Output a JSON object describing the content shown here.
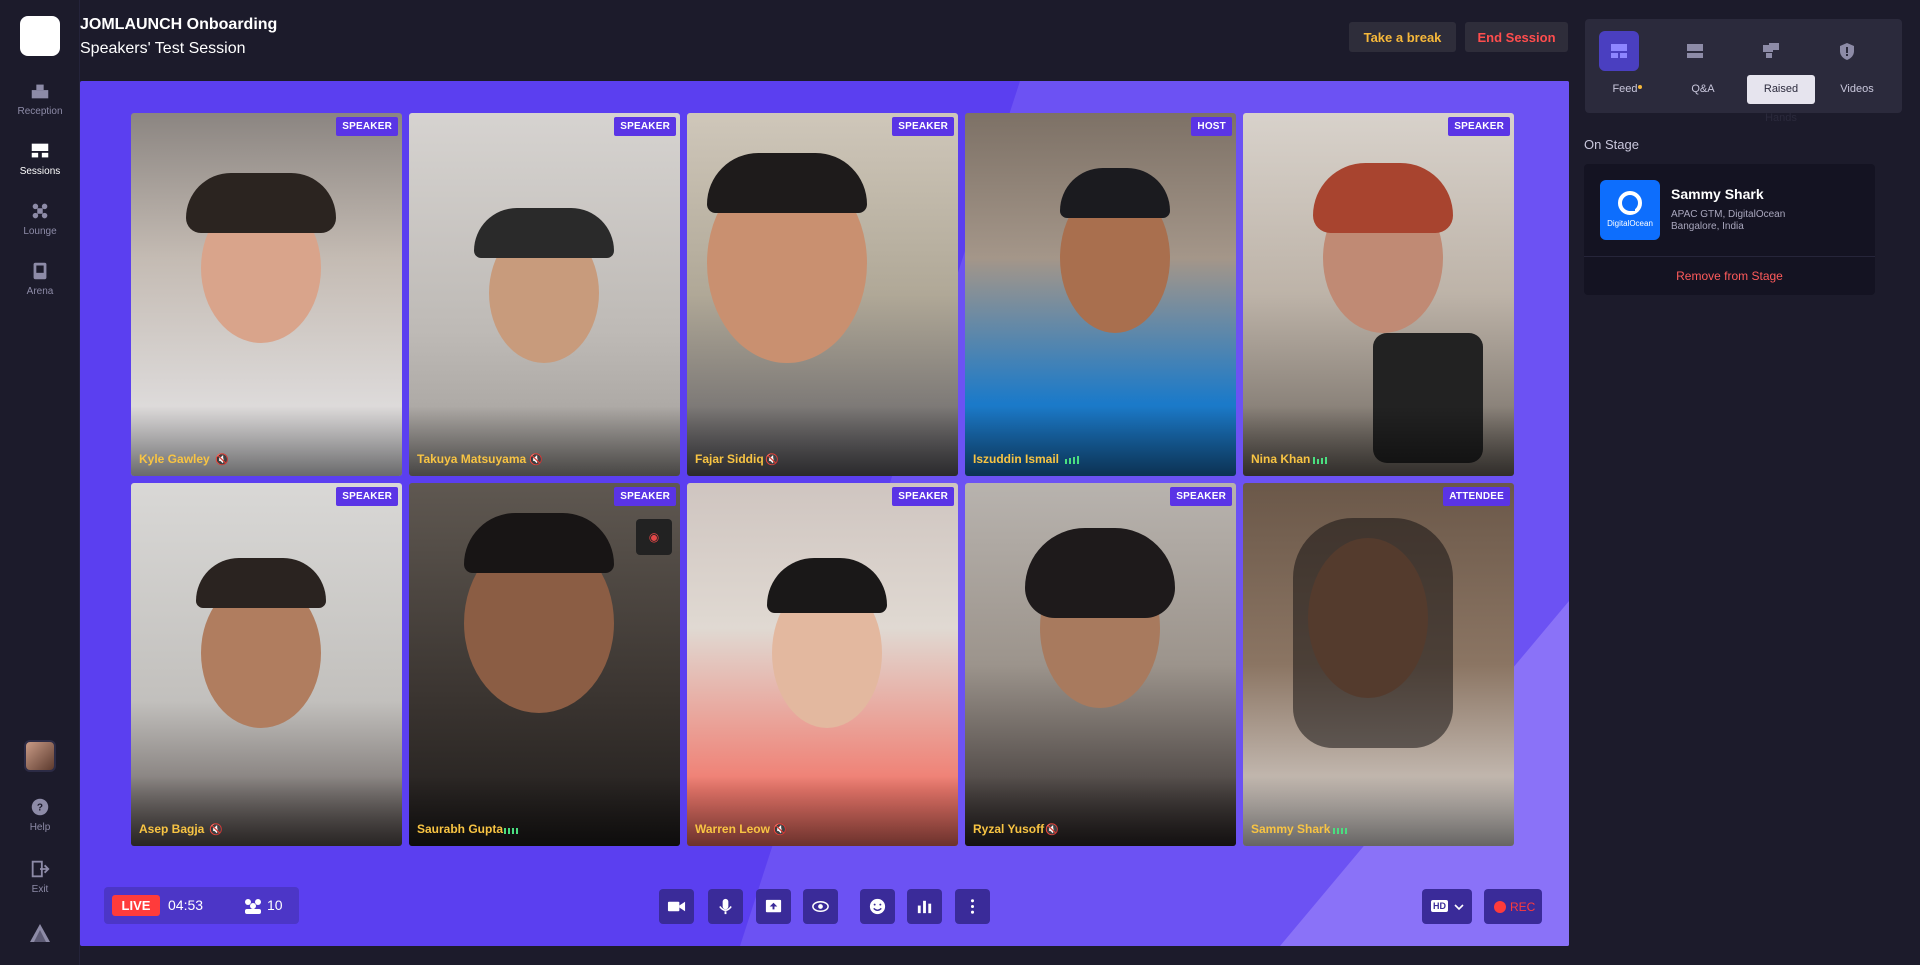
{
  "app": {
    "title": "JOMLAUNCH Onboarding",
    "subtitle": "Speakers' Test Session"
  },
  "nav": {
    "items": [
      {
        "label": "Reception",
        "icon": "reception-icon",
        "active": false
      },
      {
        "label": "Sessions",
        "icon": "sessions-icon",
        "active": true
      },
      {
        "label": "Lounge",
        "icon": "lounge-icon",
        "active": false
      },
      {
        "label": "Arena",
        "icon": "arena-icon",
        "active": false
      }
    ],
    "help": "Help",
    "exit": "Exit"
  },
  "header": {
    "break_label": "Take a break",
    "end_label": "End Session"
  },
  "participants": [
    {
      "name": "Kyle Gawley",
      "role": "SPEAKER",
      "audio": "muted"
    },
    {
      "name": "Takuya Matsuyama",
      "role": "SPEAKER",
      "audio": "muted"
    },
    {
      "name": "Fajar Siddiq",
      "role": "SPEAKER",
      "audio": "muted"
    },
    {
      "name": "Iszuddin Ismail",
      "role": "HOST",
      "audio": "speaking"
    },
    {
      "name": "Nina Khan",
      "role": "SPEAKER",
      "audio": "speaking"
    },
    {
      "name": "Asep Bagja",
      "role": "SPEAKER",
      "audio": "muted"
    },
    {
      "name": "Saurabh Gupta",
      "role": "SPEAKER",
      "audio": "speaking"
    },
    {
      "name": "Warren Leow",
      "role": "SPEAKER",
      "audio": "muted"
    },
    {
      "name": "Ryzal Yusoff",
      "role": "SPEAKER",
      "audio": "muted"
    },
    {
      "name": "Sammy Shark",
      "role": "ATTENDEE",
      "audio": "speaking"
    }
  ],
  "bottom_bar": {
    "live_label": "LIVE",
    "timer": "04:53",
    "attendee_count": "10",
    "quality_label": "HD",
    "rec_label": "REC"
  },
  "panel": {
    "tabs": [
      {
        "label": "Feed",
        "icon": "feed-icon",
        "active": false,
        "dot": true
      },
      {
        "label": "Q&A",
        "icon": "qa-icon",
        "active": false
      },
      {
        "label": "Raised Hands",
        "icon": "raised-hands-icon",
        "active": true
      },
      {
        "label": "Videos",
        "icon": "videos-icon",
        "active": false
      }
    ],
    "onstage_title": "On Stage",
    "card": {
      "name": "Sammy Shark",
      "line1": "APAC GTM, DigitalOcean",
      "line2": "Bangalore, India",
      "logo_text": "DigitalOcean",
      "remove_label": "Remove from Stage"
    }
  },
  "colors": {
    "stage": "#5b3ff0",
    "badge": "#5a34e6",
    "name_text": "#f8c443",
    "live": "#ff3b3b",
    "break_text": "#f6b83a",
    "end_text": "#ff4d4d"
  }
}
